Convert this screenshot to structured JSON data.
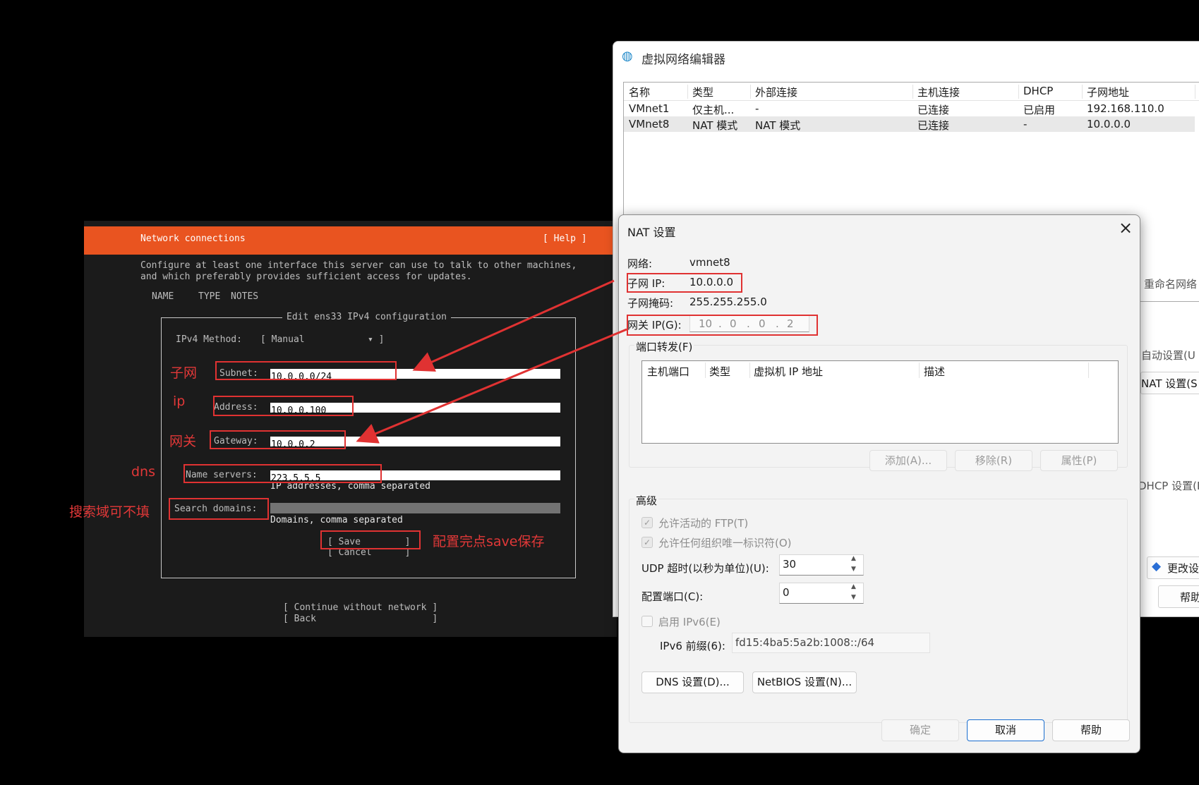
{
  "terminal": {
    "header_title": "Network connections",
    "help": "[ Help ]",
    "desc_line1": "Configure at least one interface this server can use to talk to other machines,",
    "desc_line2": "and which preferably provides sufficient access for updates.",
    "col_name": "NAME",
    "col_type": "TYPE",
    "col_notes": "NOTES",
    "dialog_title": "Edit ens33 IPv4 configuration",
    "method_label": "IPv4 Method:",
    "method_value": "[ Manual",
    "method_arrow": "▾ ]",
    "subnet_label": "Subnet:",
    "subnet_value": "10.0.0.0/24",
    "address_label": "Address:",
    "address_value": "10.0.0.100",
    "gateway_label": "Gateway:",
    "gateway_value": "10.0.0.2",
    "ns_label": "Name servers:",
    "ns_value": "223.5.5.5",
    "ns_hint": "IP addresses, comma separated",
    "sd_label": "Search domains:",
    "sd_hint": "Domains, comma separated",
    "save": "[ Save        ]",
    "cancel": "[ Cancel      ]",
    "continue": "[ Continue without network ]",
    "back": "[ Back                     ]"
  },
  "annotations": {
    "subnet": "子网",
    "ip": "ip",
    "gateway": "网关",
    "dns": "dns",
    "search": "搜索域可不填",
    "save": "配置完点save保存"
  },
  "vne": {
    "title": "虚拟网络编辑器",
    "headers": [
      "名称",
      "类型",
      "外部连接",
      "主机连接",
      "DHCP",
      "子网地址"
    ],
    "rows": [
      [
        "VMnet1",
        "仅主机...",
        "-",
        "已连接",
        "已启用",
        "192.168.110.0"
      ],
      [
        "VMnet8",
        "NAT 模式",
        "NAT 模式",
        "已连接",
        "-",
        "10.0.0.0"
      ]
    ],
    "side_rename": "重命名网络",
    "side_auto": "自动设置(U",
    "side_nat": "NAT 设置(S",
    "side_dhcp": "DHCP 设置(P",
    "side_change": "更改设",
    "side_help": "帮助"
  },
  "nat": {
    "title": "NAT 设置",
    "network_label": "网络:",
    "network_value": "vmnet8",
    "subnet_ip_label": "子网 IP:",
    "subnet_ip_value": "10.0.0.0",
    "mask_label": "子网掩码:",
    "mask_value": "255.255.255.0",
    "gw_label": "网关 IP(G):",
    "gw_octets": [
      "10",
      "0",
      "0",
      "2"
    ],
    "port_fwd": "端口转发(F)",
    "pf_headers": [
      "主机端口",
      "类型",
      "虚拟机 IP 地址",
      "描述"
    ],
    "add": "添加(A)...",
    "remove": "移除(R)",
    "props": "属性(P)",
    "advanced": "高级",
    "ftp": "允许活动的 FTP(T)",
    "oui": "允许任何组织唯一标识符(O)",
    "udp_label": "UDP 超时(以秒为单位)(U):",
    "udp_value": "30",
    "cfg_port_label": "配置端口(C):",
    "cfg_port_value": "0",
    "ipv6": "启用 IPv6(E)",
    "ipv6_prefix_label": "IPv6 前缀(6):",
    "ipv6_prefix_value": "fd15:4ba5:5a2b:1008::/64",
    "dns_btn": "DNS 设置(D)...",
    "netbios_btn": "NetBIOS 设置(N)...",
    "ok": "确定",
    "cancel": "取消",
    "help": "帮助"
  }
}
